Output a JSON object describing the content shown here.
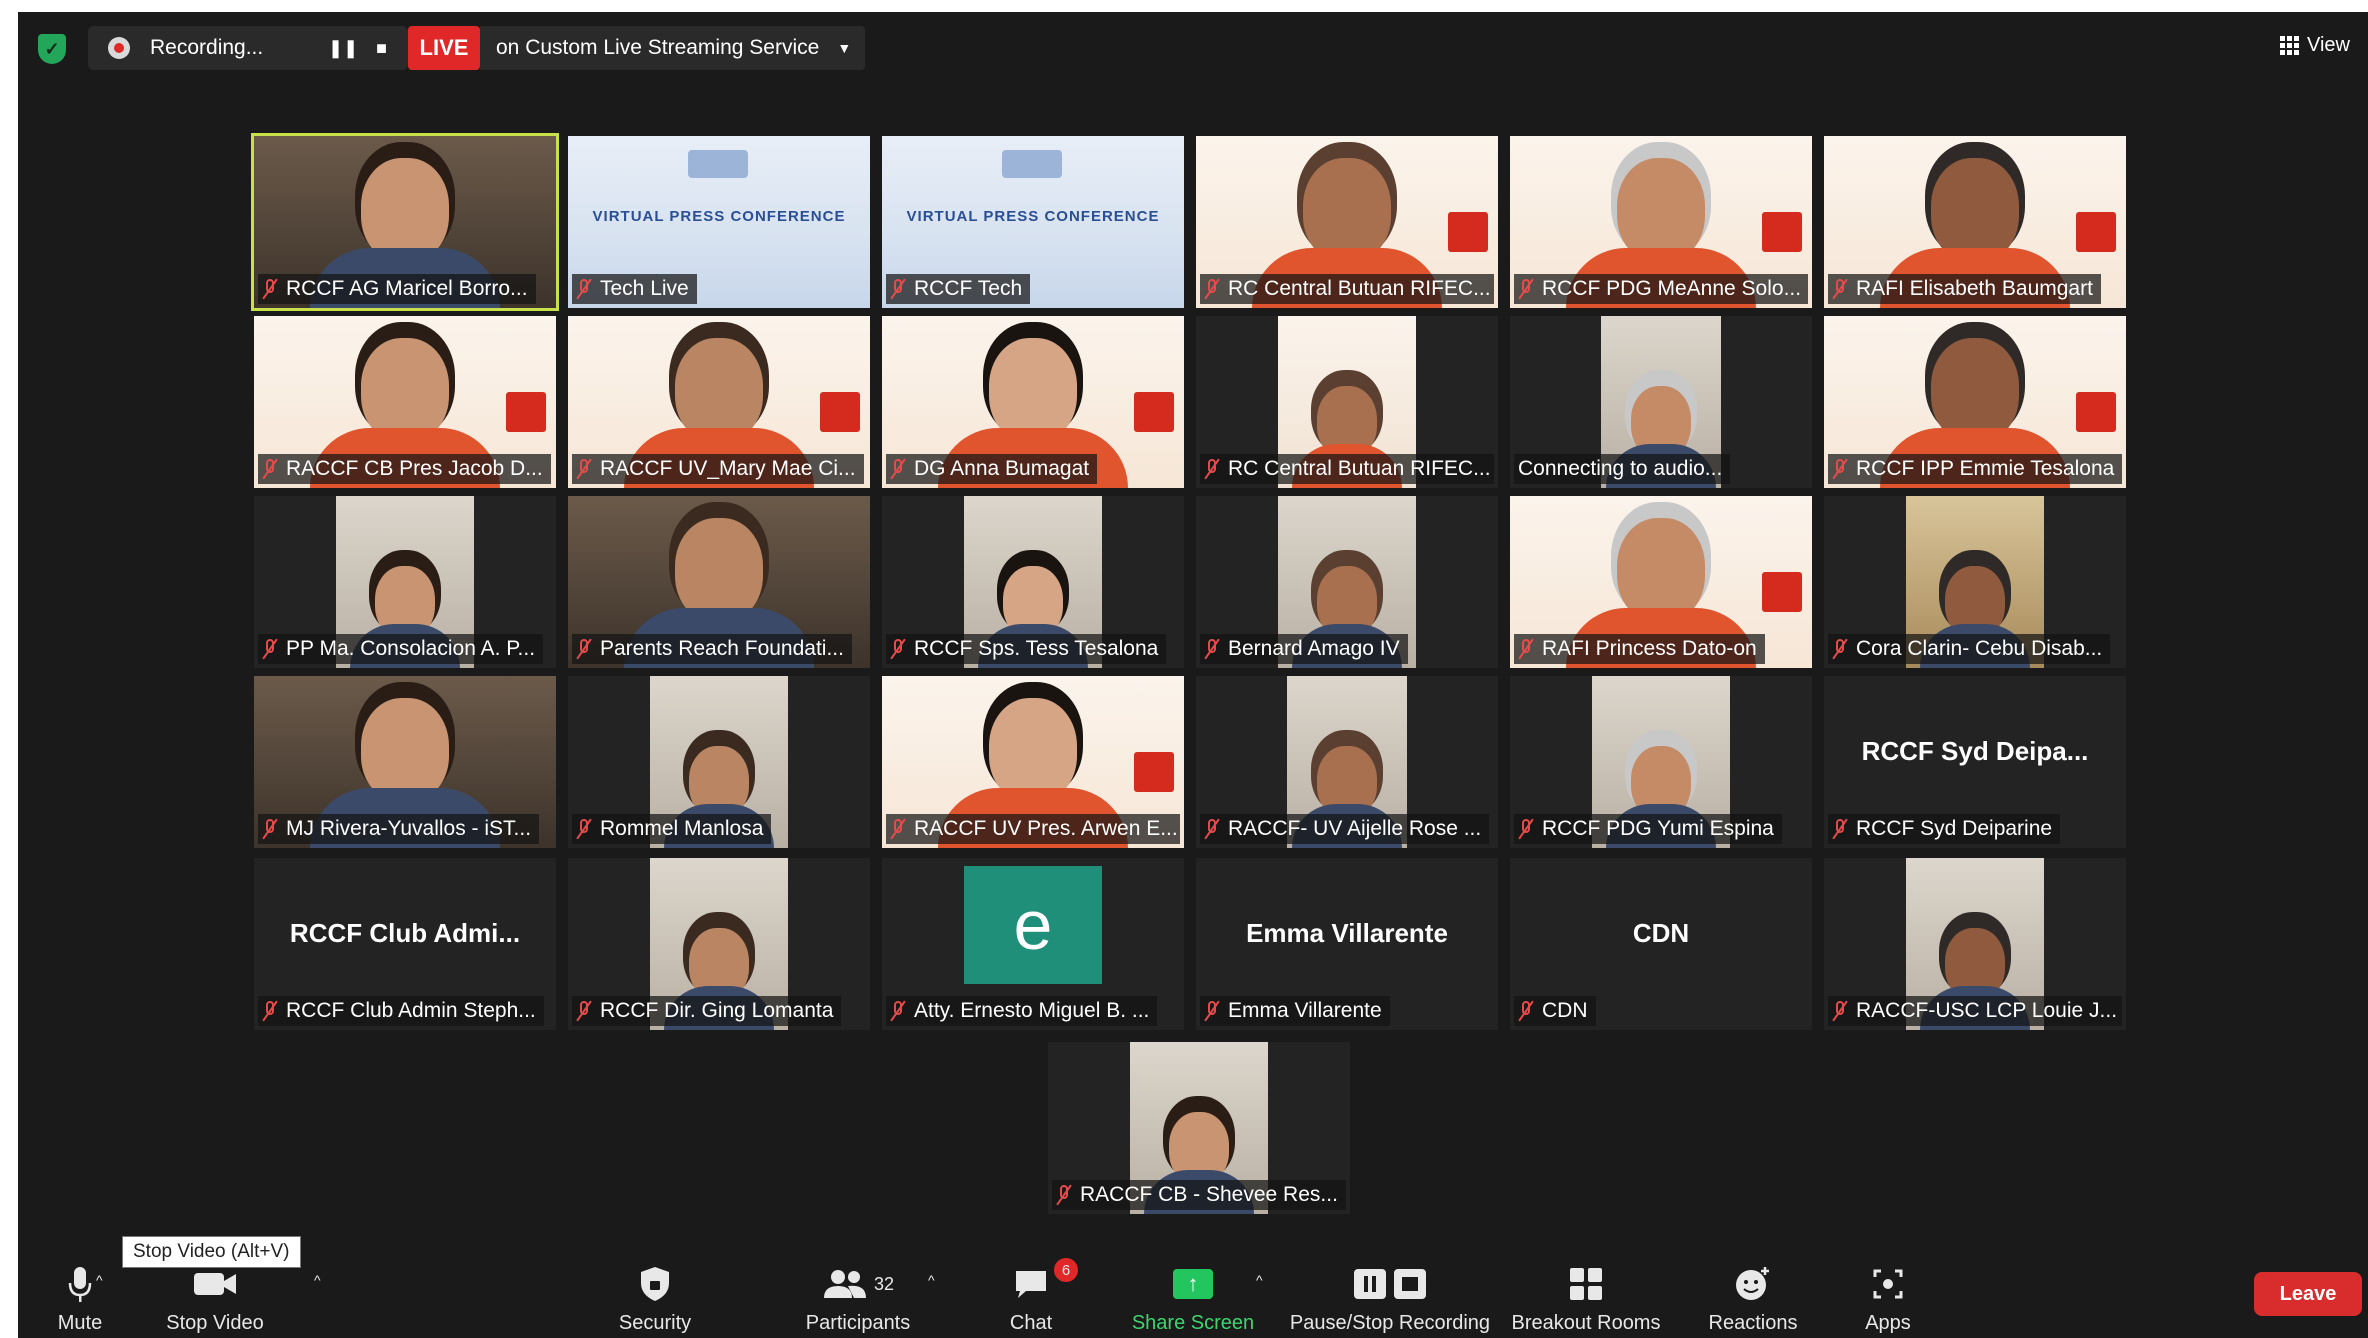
{
  "topbar": {
    "recording_label": "Recording...",
    "pause_glyph": "❚❚",
    "stop_glyph": "■",
    "live_badge": "LIVE",
    "live_service": "on Custom Live Streaming Service",
    "view_label": "View"
  },
  "tiles": [
    {
      "name": "RCCF AG Maricel Borro...",
      "bg": "room",
      "active": true
    },
    {
      "name": "Tech Live",
      "bg": "conf"
    },
    {
      "name": "RCCF Tech",
      "bg": "conf"
    },
    {
      "name": "RC Central Butuan RIFEC...",
      "bg": "warm"
    },
    {
      "name": "RCCF PDG MeAnne Solo...",
      "bg": "warm"
    },
    {
      "name": "RAFI Elisabeth Baumgart",
      "bg": "warm"
    },
    {
      "name": "RACCF CB Pres Jacob D...",
      "bg": "warm"
    },
    {
      "name": "RACCF UV_Mary Mae Ci...",
      "bg": "warm"
    },
    {
      "name": "DG Anna Bumagat",
      "bg": "warm"
    },
    {
      "name": "RC Central Butuan RIFEC...",
      "bg": "warm_narrow"
    },
    {
      "name": "Connecting to audio...",
      "bg": "narrow",
      "unmuted": true
    },
    {
      "name": "RCCF IPP Emmie Tesalona",
      "bg": "warm"
    },
    {
      "name": "PP Ma. Consolacion A. P...",
      "bg": "narrow"
    },
    {
      "name": "Parents Reach Foundati...",
      "bg": "room"
    },
    {
      "name": "RCCF Sps. Tess Tesalona",
      "bg": "narrow"
    },
    {
      "name": "Bernard Amago IV",
      "bg": "narrow"
    },
    {
      "name": "RAFI Princess Dato-on",
      "bg": "warm"
    },
    {
      "name": "Cora Clarin- Cebu Disab...",
      "bg": "narrow_room"
    },
    {
      "name": "MJ Rivera-Yuvallos - iST...",
      "bg": "room"
    },
    {
      "name": "Rommel Manlosa",
      "bg": "narrow"
    },
    {
      "name": "RACCF UV Pres. Arwen E...",
      "bg": "warm"
    },
    {
      "name": "RACCF- UV Aijelle Rose ...",
      "bg": "narrow"
    },
    {
      "name": "RCCF PDG Yumi Espina",
      "bg": "narrow"
    },
    {
      "name": "RCCF Syd Deiparine",
      "big": "RCCF Syd Deipa..."
    },
    {
      "name": "RCCF Club Admin Steph...",
      "big": "RCCF Club Admi..."
    },
    {
      "name": "RCCF Dir. Ging Lomanta",
      "bg": "narrow"
    },
    {
      "name": "Atty. Ernesto Miguel B. ...",
      "avatar": "e"
    },
    {
      "name": "Emma Villarente",
      "big": "Emma Villarente"
    },
    {
      "name": "CDN",
      "big": "CDN"
    },
    {
      "name": "RACCF-USC LCP Louie J...",
      "bg": "narrow"
    },
    {
      "name": "RACCF CB - Shevee Res...",
      "bg": "narrow"
    }
  ],
  "conf_text": "VIRTUAL PRESS CONFERENCE",
  "toolbar": {
    "mute": "Mute",
    "stop_video": "Stop Video",
    "tooltip": "Stop Video (Alt+V)",
    "security": "Security",
    "participants": "Participants",
    "participants_count": "32",
    "chat": "Chat",
    "chat_badge": "6",
    "share_screen": "Share Screen",
    "pause_stop_recording": "Pause/Stop Recording",
    "breakout_rooms": "Breakout Rooms",
    "reactions": "Reactions",
    "apps": "Apps",
    "leave": "Leave"
  },
  "colors": {
    "active_speaker": "#c8e04a",
    "live_red": "#e02828",
    "share_green": "#23c55e",
    "leave_red": "#d92c2c"
  }
}
